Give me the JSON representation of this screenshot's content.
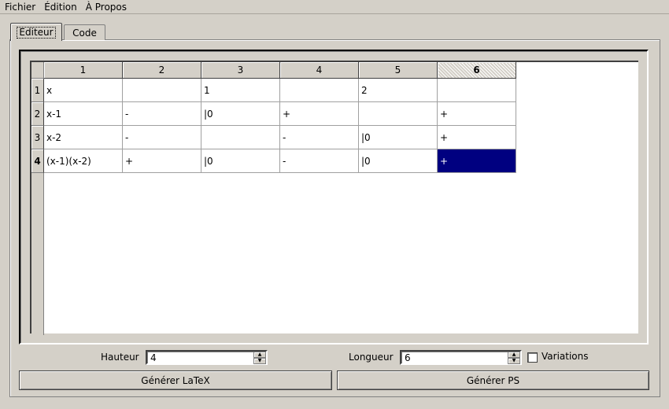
{
  "menu": [
    "Fichier",
    "Édition",
    "À Propos"
  ],
  "tabs": [
    {
      "label": "Editeur",
      "active": true
    },
    {
      "label": "Code",
      "active": false
    }
  ],
  "table": {
    "columns": [
      "1",
      "2",
      "3",
      "4",
      "5",
      "6"
    ],
    "rows": [
      "1",
      "2",
      "3",
      "4"
    ],
    "current_column": "6",
    "current_row": "4",
    "cells": [
      [
        "x",
        "",
        "1",
        "",
        "2",
        ""
      ],
      [
        "x-1",
        "-",
        "|0",
        "+",
        "",
        "+"
      ],
      [
        "x-2",
        "-",
        "",
        "-",
        "|0",
        "+"
      ],
      [
        "(x-1)(x-2)",
        "+",
        "|0",
        "-",
        "|0",
        "+"
      ]
    ],
    "selection_color": "#000080"
  },
  "controls": {
    "height_label": "Hauteur",
    "height_value": "4",
    "width_label": "Longueur",
    "width_value": "6",
    "variations_label": "Variations",
    "variations_checked": false
  },
  "buttons": {
    "latex": "Générer LaTeX",
    "ps": "Générer PS"
  }
}
